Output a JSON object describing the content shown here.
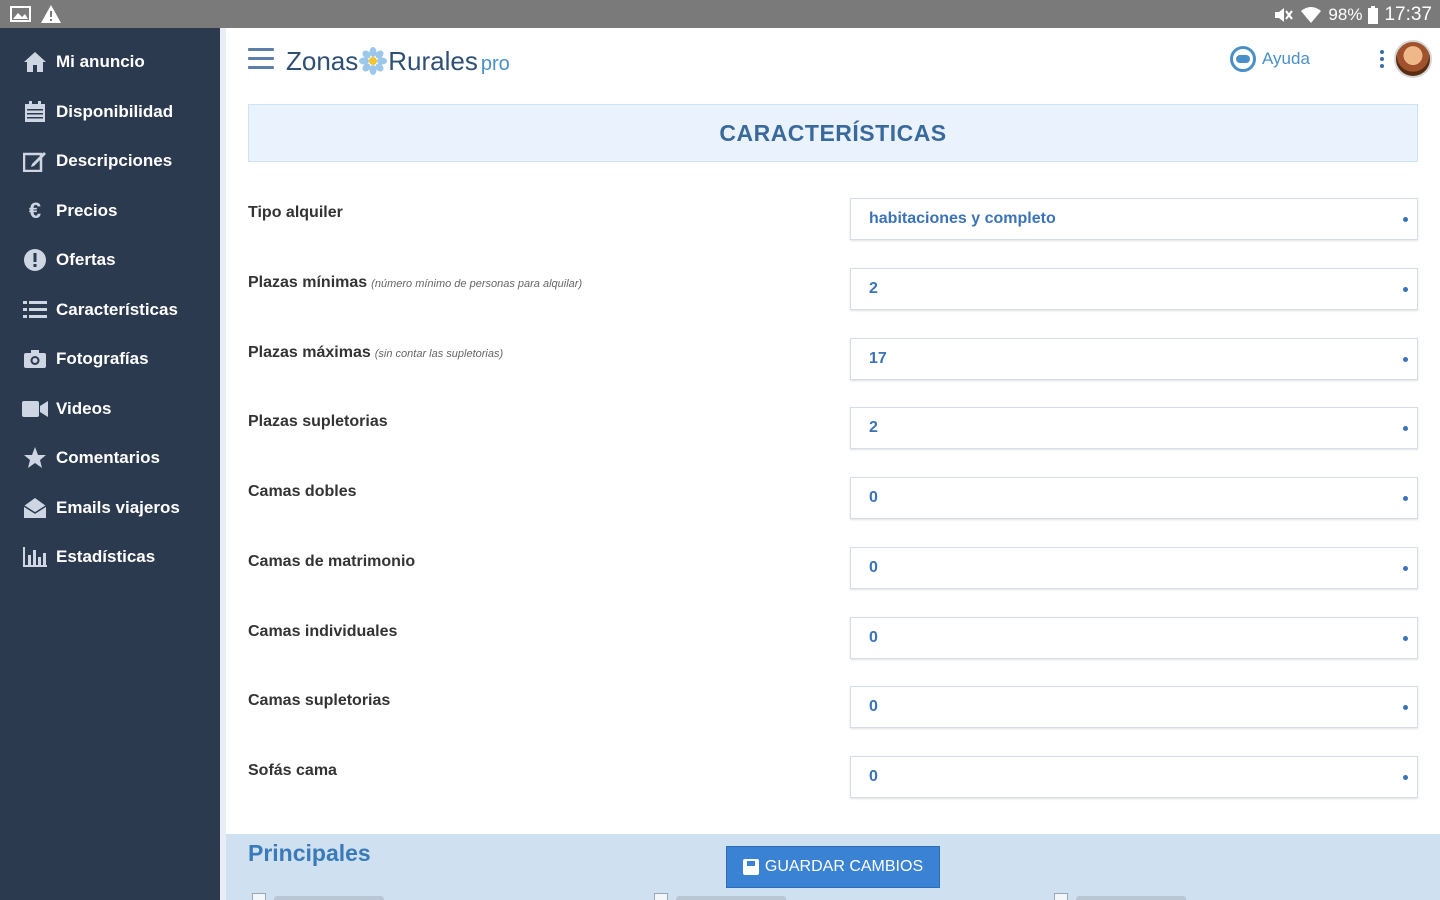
{
  "status_bar": {
    "battery": "98%",
    "time": "17:37",
    "icons": [
      "image-icon",
      "warning-icon",
      "mute-icon",
      "wifi-icon",
      "battery-icon"
    ]
  },
  "sidebar": {
    "items": [
      {
        "label": "Mi anuncio",
        "icon": "home-icon"
      },
      {
        "label": "Disponibilidad",
        "icon": "calendar-icon"
      },
      {
        "label": "Descripciones",
        "icon": "edit-icon"
      },
      {
        "label": "Precios",
        "icon": "euro-icon"
      },
      {
        "label": "Ofertas",
        "icon": "alert-circle-icon"
      },
      {
        "label": "Características",
        "icon": "list-icon"
      },
      {
        "label": "Fotografías",
        "icon": "camera-icon"
      },
      {
        "label": "Videos",
        "icon": "video-icon"
      },
      {
        "label": "Comentarios",
        "icon": "star-icon"
      },
      {
        "label": "Emails viajeros",
        "icon": "envelope-open-icon"
      },
      {
        "label": "Estadísticas",
        "icon": "bar-chart-icon"
      }
    ]
  },
  "header": {
    "logo_part1": "Zonas",
    "logo_part2": "Rurales",
    "logo_suffix": "pro",
    "help_label": "Ayuda"
  },
  "section": {
    "title": "CARACTERÍSTICAS"
  },
  "fields": [
    {
      "label": "Tipo alquiler",
      "hint": "",
      "value": "habitaciones y completo"
    },
    {
      "label": "Plazas mínimas",
      "hint": "(número mínimo de personas para alquilar)",
      "value": "2"
    },
    {
      "label": "Plazas máximas",
      "hint": "(sin contar las supletorias)",
      "value": "17"
    },
    {
      "label": "Plazas supletorias",
      "hint": "",
      "value": "2"
    },
    {
      "label": "Camas dobles",
      "hint": "",
      "value": "0"
    },
    {
      "label": "Camas de matrimonio",
      "hint": "",
      "value": "0"
    },
    {
      "label": "Camas individuales",
      "hint": "",
      "value": "0"
    },
    {
      "label": "Camas supletorias",
      "hint": "",
      "value": "0"
    },
    {
      "label": "Sofás cama",
      "hint": "",
      "value": "0"
    }
  ],
  "bottom": {
    "subsection_title": "Principales",
    "save_label": "GUARDAR CAMBIOS"
  },
  "colors": {
    "sidebar_bg": "#2c3a4f",
    "accent": "#3a82d4",
    "header_bg": "#eaf3fd",
    "value_text": "#3b73b9"
  }
}
